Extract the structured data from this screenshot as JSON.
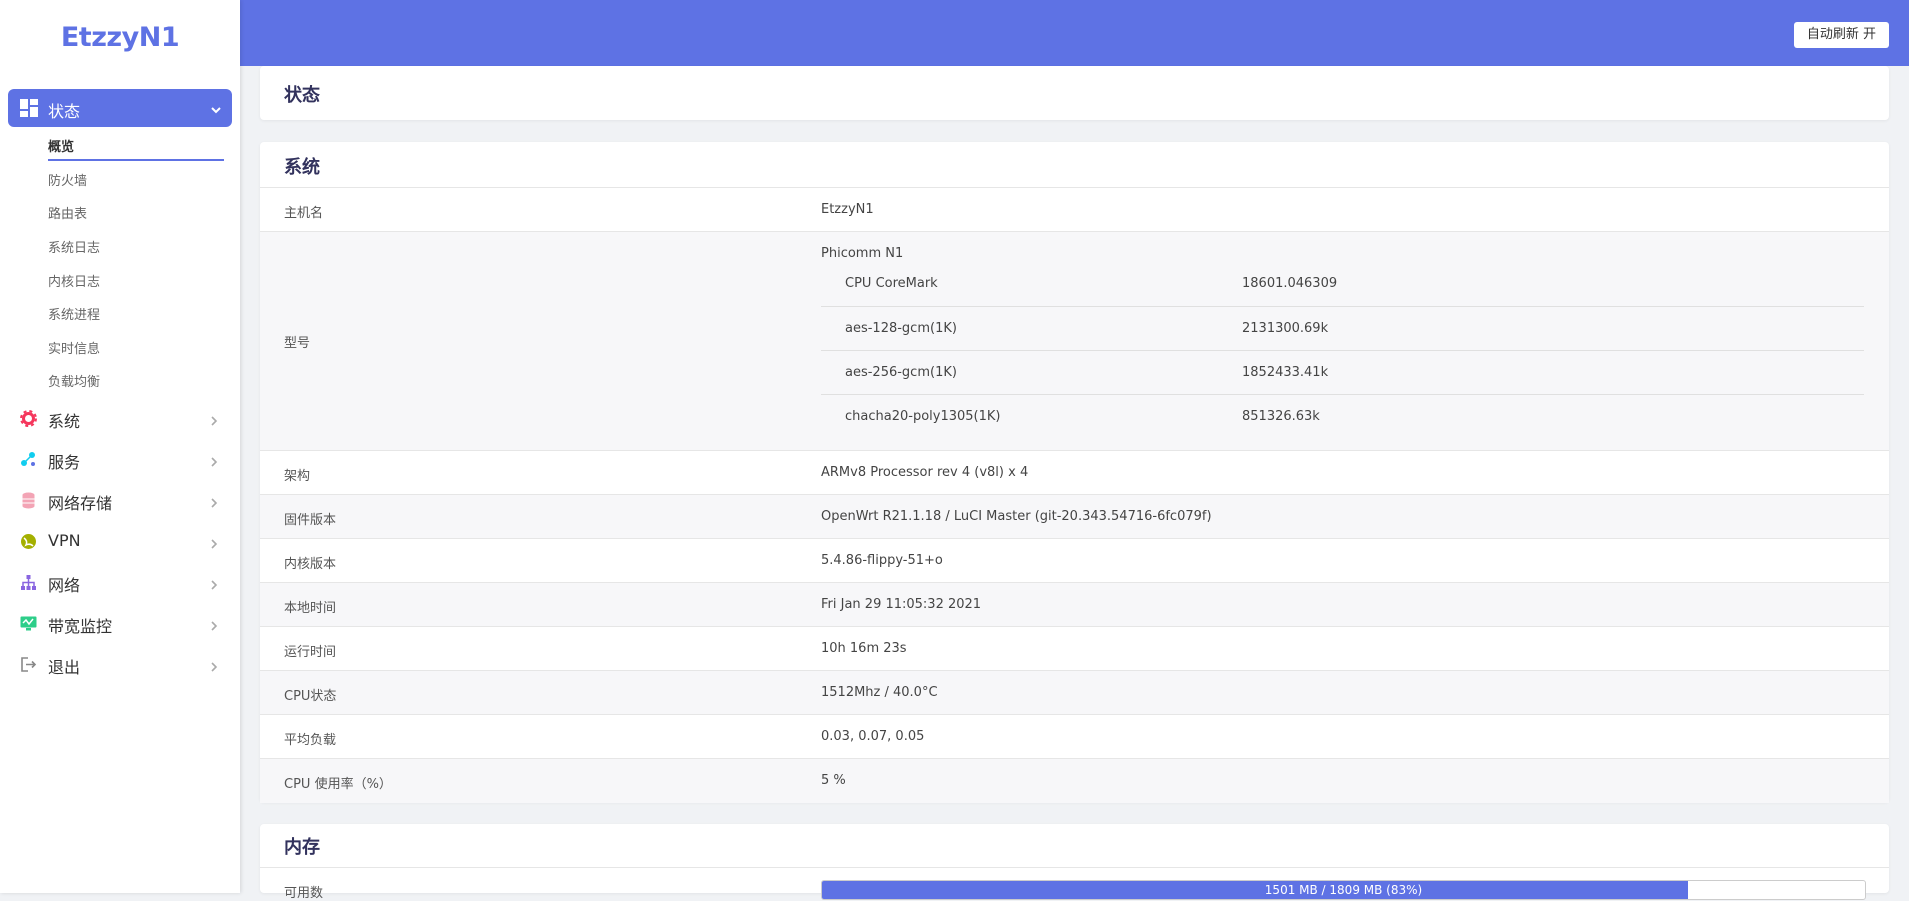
{
  "brand": {
    "logo_text": "EtzzyN1",
    "accent": "#5e72e4"
  },
  "header": {
    "refresh_button": "自动刷新 开"
  },
  "sidebar": {
    "active": {
      "label": "状态",
      "icon": "dashboard-icon"
    },
    "subitems": [
      "概览",
      "防火墙",
      "路由表",
      "系统日志",
      "内核日志",
      "系统进程",
      "实时信息",
      "负载均衡"
    ],
    "items": [
      {
        "label": "系统",
        "icon": "gear-icon",
        "color": "#f5365c"
      },
      {
        "label": "服务",
        "icon": "network-nodes-icon",
        "color": "#11cdef"
      },
      {
        "label": "网络存储",
        "icon": "database-icon",
        "color": "#f3a4b5"
      },
      {
        "label": "VPN",
        "icon": "globe-icon",
        "color": "#a4b000"
      },
      {
        "label": "网络",
        "icon": "sitemap-icon",
        "color": "#8965e0"
      },
      {
        "label": "带宽监控",
        "icon": "monitor-icon",
        "color": "#2dce89"
      },
      {
        "label": "退出",
        "icon": "logout-icon",
        "color": "#888888"
      }
    ]
  },
  "status_card": {
    "title": "状态"
  },
  "system_card": {
    "title": "系统",
    "hostname": {
      "label": "主机名",
      "value": "EtzzyN1"
    },
    "model": {
      "label": "型号",
      "value": "Phicomm N1",
      "benchmarks": [
        {
          "name": "CPU CoreMark",
          "value": "18601.046309"
        },
        {
          "name": "aes-128-gcm(1K)",
          "value": "2131300.69k"
        },
        {
          "name": "aes-256-gcm(1K)",
          "value": "1852433.41k"
        },
        {
          "name": "chacha20-poly1305(1K)",
          "value": "851326.63k"
        }
      ]
    },
    "rows": [
      {
        "label": "架构",
        "value": "ARMv8 Processor rev 4 (v8l) x 4"
      },
      {
        "label": "固件版本",
        "value": "OpenWrt R21.1.18 / LuCI Master (git-20.343.54716-6fc079f)"
      },
      {
        "label": "内核版本",
        "value": "5.4.86-flippy-51+o"
      },
      {
        "label": "本地时间",
        "value": "Fri Jan 29 11:05:32 2021"
      },
      {
        "label": "运行时间",
        "value": "10h 16m 23s"
      },
      {
        "label": "CPU状态",
        "value": "1512Mhz / 40.0°C"
      },
      {
        "label": "平均负载",
        "value": "0.03, 0.07, 0.05"
      },
      {
        "label": "CPU 使用率（%）",
        "value": "5 %"
      }
    ]
  },
  "memory_card": {
    "title": "内存",
    "available": {
      "label": "可用数",
      "text": "1501 MB / 1809 MB (83%)",
      "fraction": 0.83
    }
  }
}
